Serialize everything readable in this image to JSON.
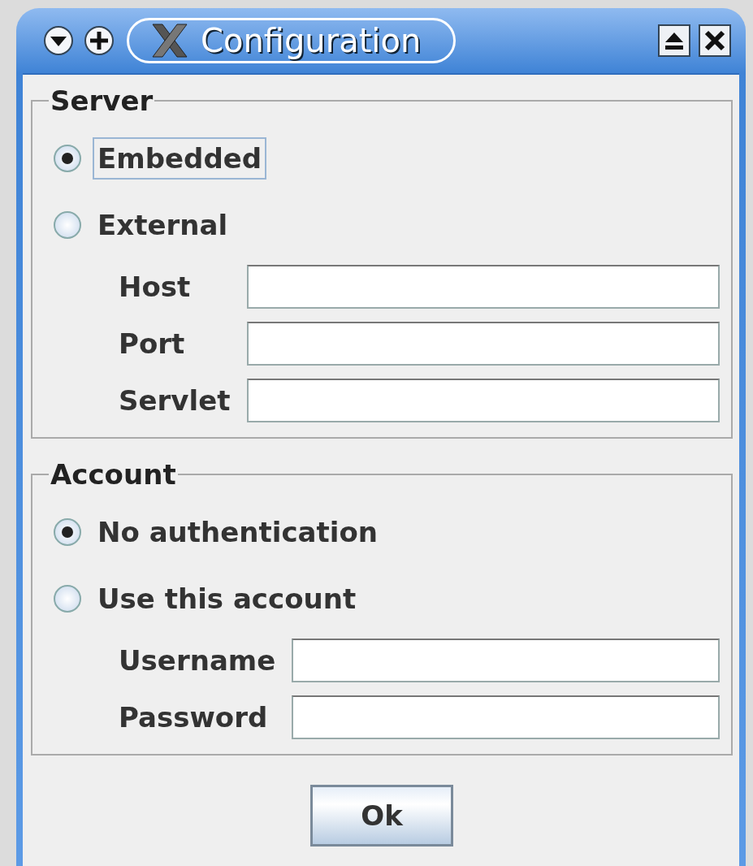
{
  "window": {
    "title": "Configuration"
  },
  "groups": [
    {
      "legend": "Server",
      "options": [
        {
          "label": "Embedded",
          "selected": true,
          "focused": true
        },
        {
          "label": "External",
          "selected": false,
          "focused": false
        }
      ],
      "fields": [
        {
          "label": "Host"
        },
        {
          "label": "Port"
        },
        {
          "label": "Servlet"
        }
      ]
    },
    {
      "legend": "Account",
      "options": [
        {
          "label": "No authentication",
          "selected": true,
          "focused": false
        },
        {
          "label": "Use this account",
          "selected": false,
          "focused": false
        }
      ],
      "fields": [
        {
          "label": "Username"
        },
        {
          "label": "Password"
        }
      ]
    }
  ],
  "buttons": [
    {
      "label": "Ok"
    }
  ]
}
